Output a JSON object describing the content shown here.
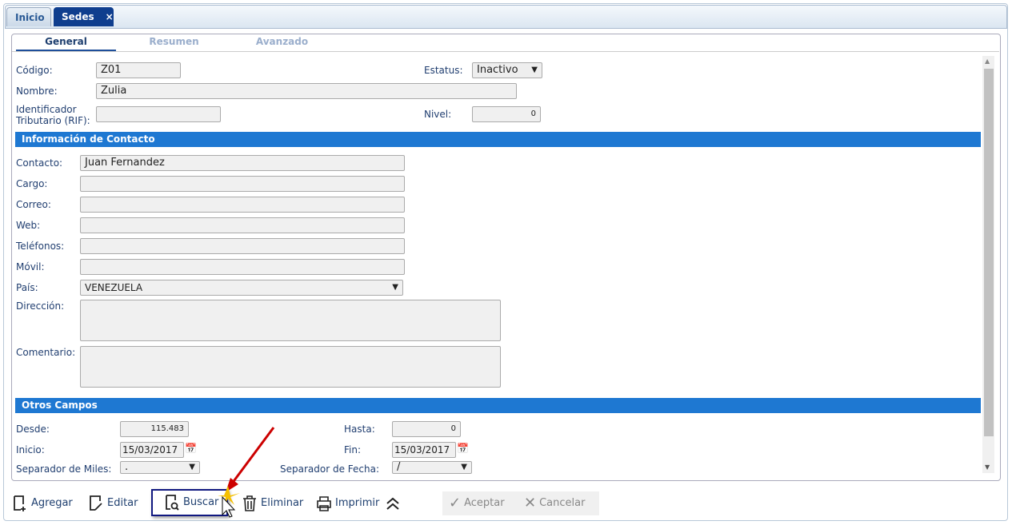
{
  "tabs": [
    {
      "label": "Inicio"
    },
    {
      "label": "Sedes",
      "close": "×"
    }
  ],
  "subtabs": [
    "General",
    "Resumen",
    "Avanzado"
  ],
  "fields": {
    "codigo": {
      "label": "Código:",
      "value": "Z01"
    },
    "estatus": {
      "label": "Estatus:",
      "value": "Inactivo"
    },
    "nombre": {
      "label": "Nombre:",
      "value": "Zulia"
    },
    "rif": {
      "label1": "Identificador",
      "label2": "Tributario (RIF):",
      "value": ""
    },
    "nivel": {
      "label": "Nivel:",
      "value": "0"
    }
  },
  "contact": {
    "title": "Información de Contacto",
    "contacto": {
      "label": "Contacto:",
      "value": "Juan  Fernandez"
    },
    "cargo": {
      "label": "Cargo:"
    },
    "correo": {
      "label": "Correo:"
    },
    "web": {
      "label": "Web:"
    },
    "telefonos": {
      "label": "Teléfonos:"
    },
    "movil": {
      "label": "Móvil:"
    },
    "pais": {
      "label": "País:",
      "value": "VENEZUELA"
    },
    "direccion": {
      "label": "Dirección:"
    },
    "comentario": {
      "label": "Comentario:"
    }
  },
  "otros": {
    "title": "Otros Campos",
    "desde": {
      "label": "Desde:",
      "value": "115.483"
    },
    "hasta": {
      "label": "Hasta:",
      "value": "0"
    },
    "inicio": {
      "label": "Inicio:",
      "value": "15/03/2017"
    },
    "fin": {
      "label": "Fin:",
      "value": "15/03/2017"
    },
    "sep_miles": {
      "label": "Separador de Miles:",
      "value": "."
    },
    "sep_fecha": {
      "label": "Separador de Fecha:",
      "value": "/"
    }
  },
  "toolbar": {
    "agregar": "Agregar",
    "editar": "Editar",
    "buscar": "Buscar",
    "eliminar": "Eliminar",
    "imprimir": "Imprimir",
    "aceptar": "Aceptar",
    "cancelar": "Cancelar"
  },
  "colors": {
    "section": "#1e78d2",
    "active_tab": "#0f3e8e"
  }
}
